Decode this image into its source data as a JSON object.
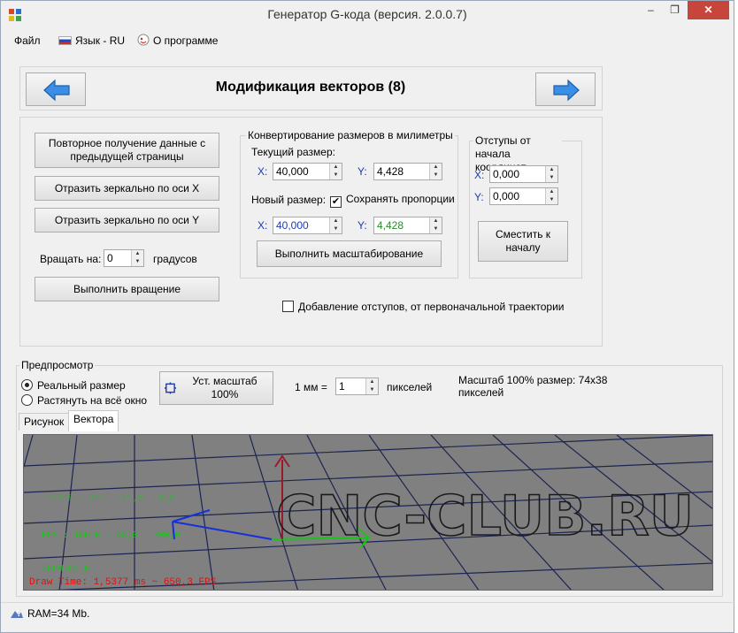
{
  "window": {
    "title": "Генератор G-кода (версия. 2.0.0.7)",
    "minimize": "–",
    "maximize": "❐",
    "close": "✕"
  },
  "menu": {
    "file": "Файл",
    "language": "Язык - RU",
    "about": "О программе"
  },
  "header": {
    "title": "Модификация векторов (8)",
    "back_icon": "arrow-left-icon",
    "forward_icon": "arrow-right-icon"
  },
  "actions": {
    "reload": "Повторное получение данные с предыдущей страницы",
    "mirror_x": "Отразить зеркально по оси X",
    "mirror_y": "Отразить зеркально по оси Y",
    "rotate_label": "Вращать на:",
    "rotate_value": "0",
    "rotate_units": "градусов",
    "rotate_button": "Выполнить вращение"
  },
  "convert": {
    "legend": "Конвертирование размеров в милиметры",
    "current_label": "Текущий размер:",
    "x_label": "X:",
    "y_label": "Y:",
    "current_x": "40,000",
    "current_y": "4,428",
    "new_label": "Новый размер:",
    "keep_proportions": "Сохранять пропорции",
    "keep_proportions_checked": "✔",
    "new_x": "40,000",
    "new_y": "4,428",
    "scale_button": "Выполнить масштабирование"
  },
  "offsets": {
    "legend": "Отступы от начала координат",
    "x_label": "X:",
    "y_label": "Y:",
    "x_value": "0,000",
    "y_value": "0,000",
    "move_button": "Сместить к началу"
  },
  "add_offsets": {
    "label": "Добавление отступов, от первоначальной траектории"
  },
  "preview": {
    "legend": "Предпросмотр",
    "radio_real": "Реальный размер",
    "radio_fit": "Растянуть на всё окно",
    "scale_button": "Уст. масштаб 100%",
    "mm_label": "1 мм =",
    "mm_value": "1",
    "pixels_label": "пикселей",
    "scale_info": "Масштаб 100% размер: 74x38 пикселей",
    "tabs": [
      "Рисунок",
      "Вектора"
    ],
    "active_tab": "Вектора"
  },
  "viewport": {
    "logo_text": "CNC-CLUB.RU",
    "state": "STATE : 155 - 45,0 - 0,0",
    "pos": "POS : 160,0 - 48,0 - 300,0",
    "zoom": "ZOOM:65,0",
    "draw_time": "Draw Time: 1,5377 ms ~ 650,3 FPS"
  },
  "status": {
    "ram": "RAM=34 Mb."
  },
  "colors": {
    "accent_blue": "#1a3bb3",
    "green_value": "#2b8a2b",
    "viewport_bg": "#808080",
    "overlay_green": "#19c419",
    "draw_time_red": "#e01010",
    "close_red": "#c7463c"
  }
}
